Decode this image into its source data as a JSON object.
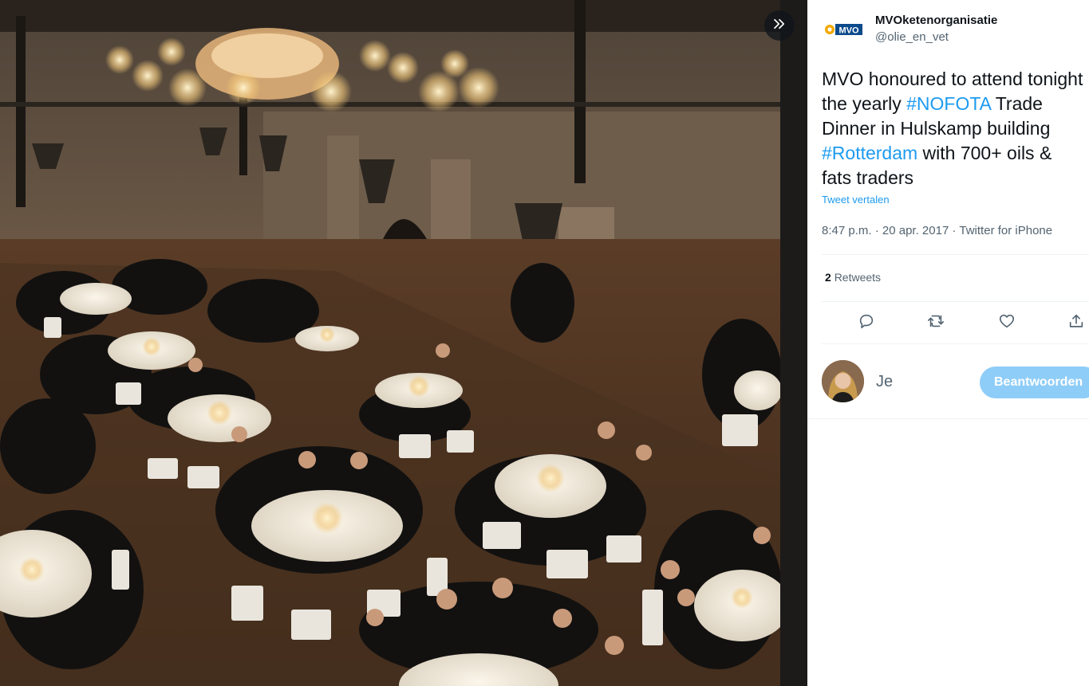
{
  "viewer": {
    "expand_icon": "double-chevron-right-icon",
    "photo_alt": "Gala dinner with round tables in a large hall"
  },
  "tweet": {
    "display_name": "MVOketenorganisatie",
    "handle": "@olie_en_vet",
    "logo_text": "MVO",
    "text_parts": {
      "p1": "MVO honoured to attend tonight the yearly ",
      "tag1": "#NOFOTA",
      "p2": " Trade Dinner in Hulskamp building ",
      "tag2": "#Rotterdam",
      "p3": " with 700+ oils & fats traders"
    },
    "translate_label": "Tweet vertalen",
    "time": "8:47 p.m.",
    "date": "20 apr. 2017",
    "source": "Twitter for iPhone",
    "retweet_count": "2",
    "retweet_label": "Retweets"
  },
  "actions": [
    "reply-icon",
    "retweet-icon",
    "like-icon",
    "share-icon"
  ],
  "reply": {
    "placeholder": "Je",
    "button_label": "Beantwoorden"
  },
  "colors": {
    "accent": "#1d9bf0",
    "reply_button": "#8ecdf8",
    "text_primary": "#0f1419",
    "text_secondary": "#536471"
  }
}
